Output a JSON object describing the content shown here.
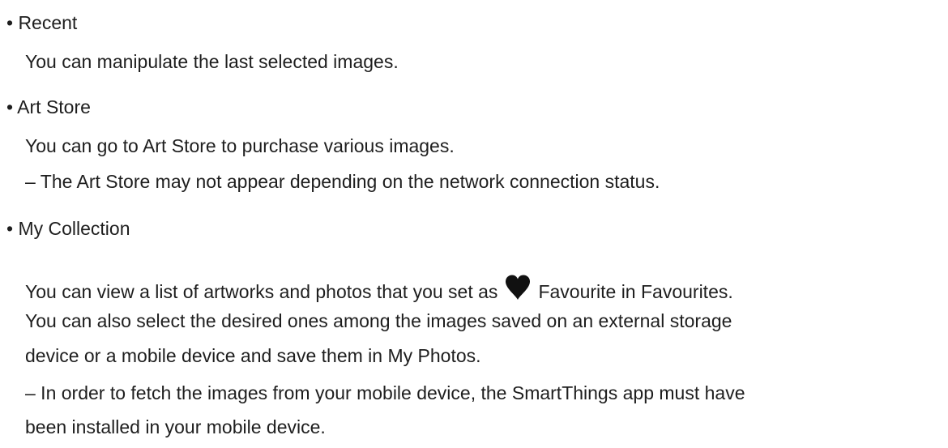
{
  "sections": [
    {
      "heading": "• Recent",
      "lines": [
        "You can manipulate the last selected images."
      ]
    },
    {
      "heading": "• Art Store",
      "lines": [
        "You can go to Art Store to purchase various images.",
        "– The Art Store may not appear depending on the network connection status."
      ]
    },
    {
      "heading": "• My Collection",
      "lines_before_icon": "You can view a list of artworks and photos that you set as",
      "icon": "heart-icon",
      "lines_after_icon": "Favourite in Favourites.",
      "lines": [
        "You can also select the desired ones among the images saved on an external storage",
        "device or a mobile device and save them in My Photos.",
        "– In order to fetch the images from your mobile device, the SmartThings app must have",
        "been installed in your mobile device."
      ]
    }
  ]
}
